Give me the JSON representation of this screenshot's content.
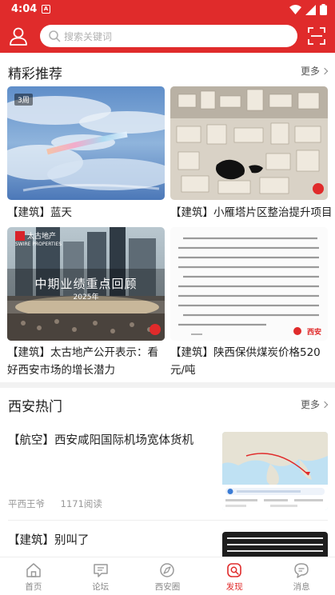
{
  "status_bar": {
    "time": "4:04",
    "notif_glyph": "A"
  },
  "header": {
    "search_placeholder": "搜索关键词"
  },
  "featured": {
    "title": "精彩推荐",
    "more": "更多",
    "cards": [
      {
        "title": "【建筑】蓝天",
        "badge": "3周"
      },
      {
        "title": "【建筑】小雁塔片区整治提升项目"
      },
      {
        "title": "【建筑】太古地产公开表示：看好西安市场的增长潜力",
        "overlay_main": "中期业绩重点回顾",
        "overlay_year": "2025年",
        "logo_cn": "太古地产",
        "logo_en": "SWIRE PROPERTIES"
      },
      {
        "title": "【建筑】陕西保供煤炭价格520元/吨",
        "watermark": "西安"
      }
    ]
  },
  "hot": {
    "title": "西安热门",
    "more": "更多",
    "items": [
      {
        "title": "【航空】西安咸阳国际机场宽体货机",
        "author": "平西王爷",
        "reads": "1171阅读"
      },
      {
        "title": "【建筑】别叫了"
      }
    ]
  },
  "nav": [
    {
      "label": "首页",
      "icon": "home-icon"
    },
    {
      "label": "论坛",
      "icon": "forum-icon"
    },
    {
      "label": "西安圈",
      "icon": "circle-icon"
    },
    {
      "label": "发现",
      "icon": "discover-icon",
      "active": true
    },
    {
      "label": "消息",
      "icon": "message-icon"
    }
  ],
  "colors": {
    "brand": "#e02b2b",
    "divider": "#f2f2f2",
    "muted": "#999999"
  }
}
